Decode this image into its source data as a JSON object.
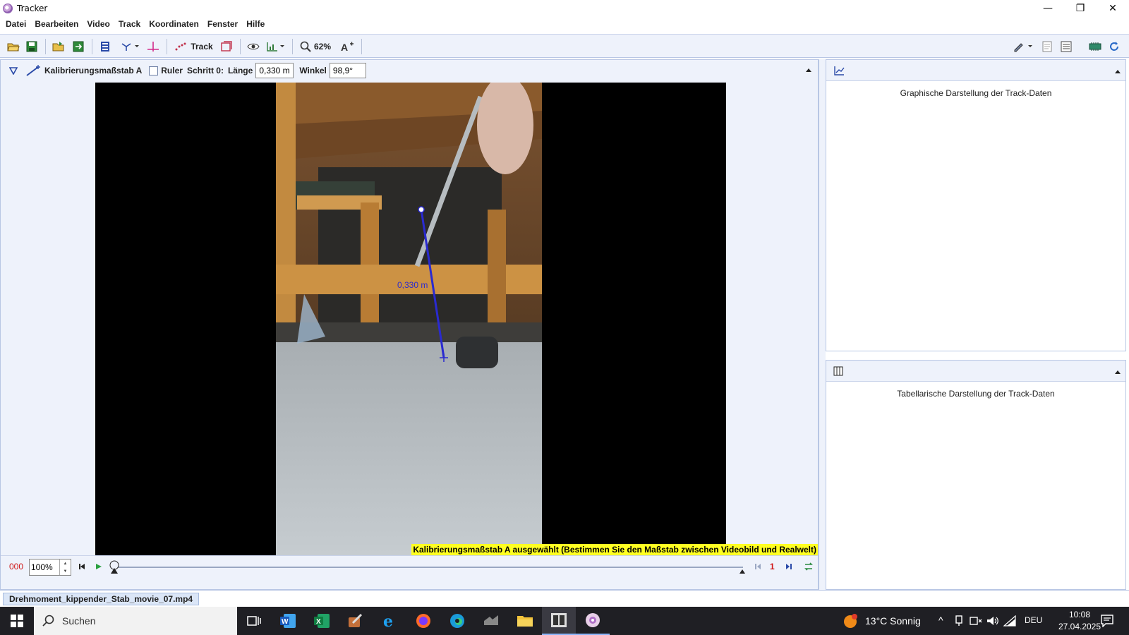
{
  "window": {
    "title": "Tracker",
    "min": "—",
    "max": "❐",
    "close": "✕"
  },
  "menu": [
    "Datei",
    "Bearbeiten",
    "Video",
    "Track",
    "Koordinaten",
    "Fenster",
    "Hilfe"
  ],
  "toolbar": {
    "track_label": "Track",
    "zoom": "62%"
  },
  "trackbar": {
    "tool_name": "Kalibrierungsmaßstab A",
    "ruler_label": "Ruler",
    "step_label": "Schritt 0:",
    "length_label": "Länge",
    "length_value": "0,330 m",
    "angle_label": "Winkel",
    "angle_value": "98,9°"
  },
  "video": {
    "measure_label": "0,330 m",
    "status": "Kalibrierungsmaßstab A ausgewählt (Bestimmen Sie den Maßstab zwischen Videobild und Realwelt)"
  },
  "player": {
    "frame": "000",
    "rate": "100%",
    "step": "1"
  },
  "panels": {
    "plot_title": "Graphische Darstellung der Track-Daten",
    "table_title": "Tabellarische Darstellung der Track-Daten"
  },
  "file_tab": "Drehmoment_kippender_Stab_movie_07.mp4",
  "taskbar": {
    "search": "Suchen",
    "weather": "13°C  Sonnig",
    "lang": "DEU",
    "time": "10:08",
    "date": "27.04.2025"
  }
}
